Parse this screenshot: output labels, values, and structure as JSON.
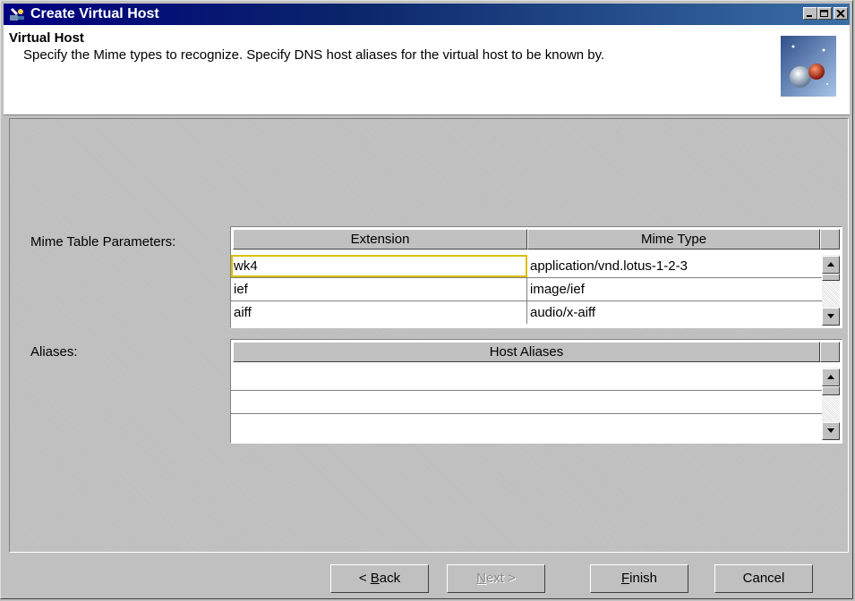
{
  "window": {
    "title": "Create Virtual Host"
  },
  "header": {
    "title": "Virtual Host",
    "description": "Specify the Mime types to recognize. Specify DNS host aliases for the virtual host to be known by."
  },
  "mime": {
    "label": "Mime Table Parameters:",
    "columns": [
      "Extension",
      "Mime Type"
    ],
    "rows": [
      {
        "extension": "wk4",
        "mime_type": "application/vnd.lotus-1-2-3"
      },
      {
        "extension": "ief",
        "mime_type": "image/ief"
      },
      {
        "extension": "aiff",
        "mime_type": "audio/x-aiff"
      }
    ]
  },
  "aliases": {
    "label": "Aliases:",
    "column": "Host Aliases",
    "rows": [
      "",
      "",
      ""
    ]
  },
  "buttons": {
    "back_prefix": "< ",
    "back_mnemonic": "B",
    "back_rest": "ack",
    "next_mnemonic": "N",
    "next_rest": "ext >",
    "finish_mnemonic": "F",
    "finish_rest": "inish",
    "cancel": "Cancel"
  },
  "icons": {
    "app": "wizard-icon",
    "header_graphic": "globe-icon",
    "minimize": "minimize-icon",
    "maximize": "maximize-icon",
    "close": "close-icon",
    "scroll_up": "arrow-up-icon",
    "scroll_down": "arrow-down-icon"
  },
  "colors": {
    "titlebar": "#000080",
    "selection_outline": "#d8c000",
    "dialog": "#c0c0c0"
  }
}
